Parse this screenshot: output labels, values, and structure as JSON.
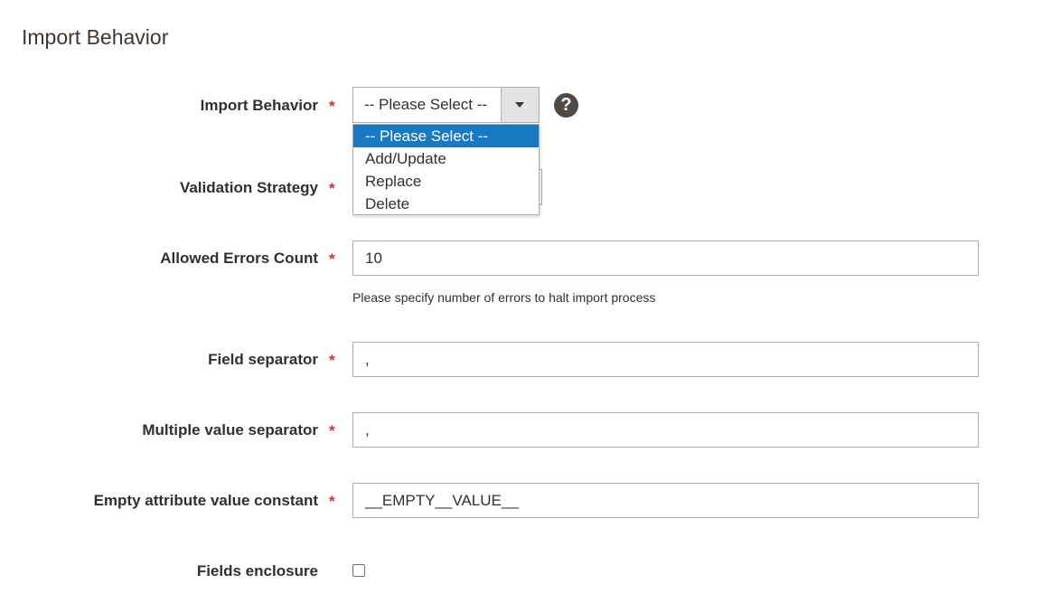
{
  "section": {
    "title": "Import Behavior"
  },
  "fields": {
    "import_behavior": {
      "label": "Import Behavior",
      "required_mark": "*",
      "selected": "-- Please Select --",
      "help_icon": "?",
      "options": [
        "-- Please Select --",
        "Add/Update",
        "Replace",
        "Delete"
      ]
    },
    "validation_strategy": {
      "label": "Validation Strategy",
      "required_mark": "*"
    },
    "allowed_errors": {
      "label": "Allowed Errors Count",
      "required_mark": "*",
      "value": "10",
      "note": "Please specify number of errors to halt import process"
    },
    "field_separator": {
      "label": "Field separator",
      "required_mark": "*",
      "value": ","
    },
    "multiple_value_separator": {
      "label": "Multiple value separator",
      "required_mark": "*",
      "value": ","
    },
    "empty_attribute": {
      "label": "Empty attribute value constant",
      "required_mark": "*",
      "value": "__EMPTY__VALUE__"
    },
    "fields_enclosure": {
      "label": "Fields enclosure",
      "checked": false
    }
  },
  "colors": {
    "required": "#e02b27",
    "selected_option": "#1979c3",
    "help_icon_bg": "#514943"
  },
  "icons": {
    "help": "question-circle-icon",
    "dropdown_arrow": "triangle-down-icon"
  }
}
